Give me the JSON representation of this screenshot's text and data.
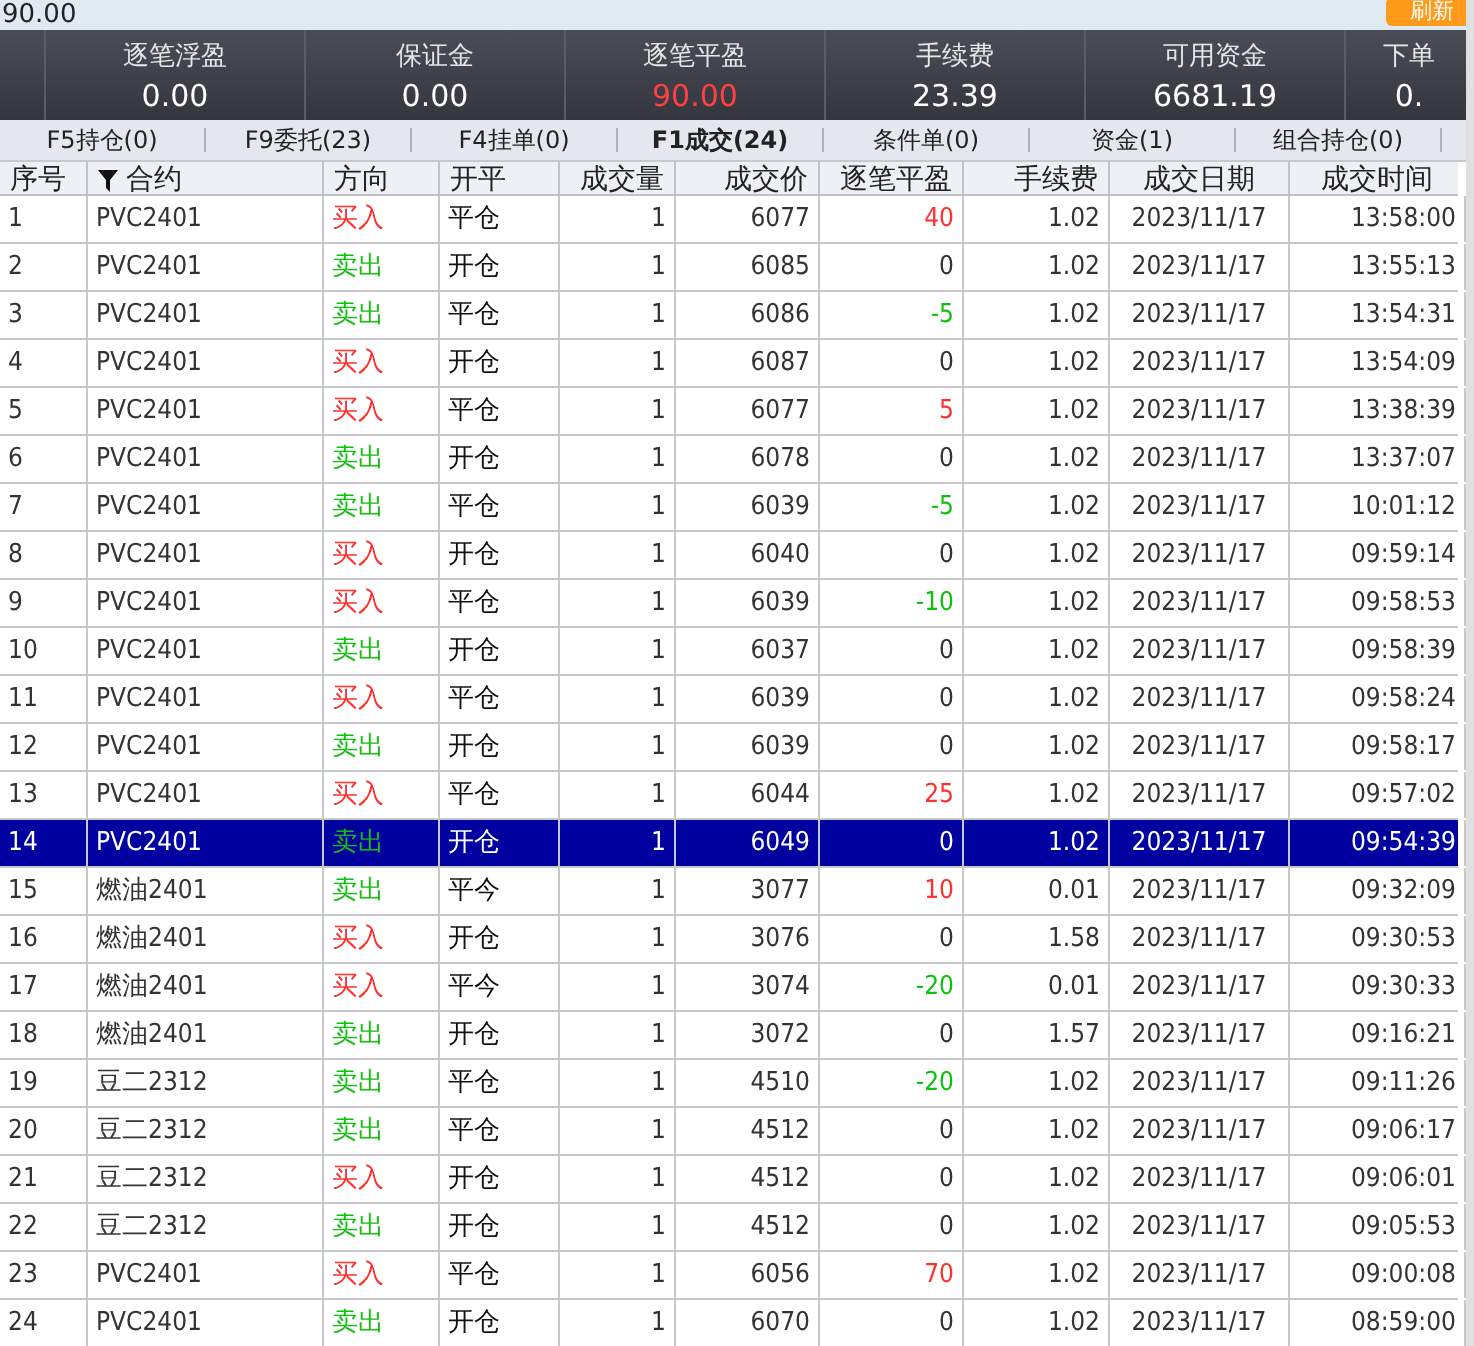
{
  "top_bar": {
    "value": "90.00",
    "refresh_button": "刷新"
  },
  "stats": [
    {
      "label": "逐笔浮盈",
      "value": "0.00",
      "color": "#ffffff"
    },
    {
      "label": "保证金",
      "value": "0.00",
      "color": "#ffffff"
    },
    {
      "label": "逐笔平盈",
      "value": "90.00",
      "color": "#ff4040"
    },
    {
      "label": "手续费",
      "value": "23.39",
      "color": "#ffffff"
    },
    {
      "label": "可用资金",
      "value": "6681.19",
      "color": "#ffffff"
    },
    {
      "label": "下单",
      "value": "0.",
      "color": "#ffffff"
    }
  ],
  "tabs": [
    {
      "label": "F5持仓(0)",
      "selected": false
    },
    {
      "label": "F9委托(23)",
      "selected": false
    },
    {
      "label": "F4挂单(0)",
      "selected": false
    },
    {
      "label": "F1成交(24)",
      "selected": true
    },
    {
      "label": "条件单(0)",
      "selected": false
    },
    {
      "label": "资金(1)",
      "selected": false
    },
    {
      "label": "组合持仓(0)",
      "selected": false
    }
  ],
  "table": {
    "columns": [
      "序号",
      "合约",
      "方向",
      "开平",
      "成交量",
      "成交价",
      "逐笔平盈",
      "手续费",
      "成交日期",
      "成交时间"
    ],
    "rows": [
      {
        "no": "1",
        "contract": "PVC2401",
        "direction": {
          "text": "买入",
          "color": "#ff3030"
        },
        "open_close": "平仓",
        "qty": "1",
        "price": "6077",
        "pnl": {
          "text": "40",
          "color": "#ff3030"
        },
        "fee": "1.02",
        "date": "2023/11/17",
        "time": "13:58:00",
        "selected": false
      },
      {
        "no": "2",
        "contract": "PVC2401",
        "direction": {
          "text": "卖出",
          "color": "#10c010"
        },
        "open_close": "开仓",
        "qty": "1",
        "price": "6085",
        "pnl": {
          "text": "0",
          "color": "#333333"
        },
        "fee": "1.02",
        "date": "2023/11/17",
        "time": "13:55:13",
        "selected": false
      },
      {
        "no": "3",
        "contract": "PVC2401",
        "direction": {
          "text": "卖出",
          "color": "#10c010"
        },
        "open_close": "平仓",
        "qty": "1",
        "price": "6086",
        "pnl": {
          "text": "-5",
          "color": "#10c010"
        },
        "fee": "1.02",
        "date": "2023/11/17",
        "time": "13:54:31",
        "selected": false
      },
      {
        "no": "4",
        "contract": "PVC2401",
        "direction": {
          "text": "买入",
          "color": "#ff3030"
        },
        "open_close": "开仓",
        "qty": "1",
        "price": "6087",
        "pnl": {
          "text": "0",
          "color": "#333333"
        },
        "fee": "1.02",
        "date": "2023/11/17",
        "time": "13:54:09",
        "selected": false
      },
      {
        "no": "5",
        "contract": "PVC2401",
        "direction": {
          "text": "买入",
          "color": "#ff3030"
        },
        "open_close": "平仓",
        "qty": "1",
        "price": "6077",
        "pnl": {
          "text": "5",
          "color": "#ff3030"
        },
        "fee": "1.02",
        "date": "2023/11/17",
        "time": "13:38:39",
        "selected": false
      },
      {
        "no": "6",
        "contract": "PVC2401",
        "direction": {
          "text": "卖出",
          "color": "#10c010"
        },
        "open_close": "开仓",
        "qty": "1",
        "price": "6078",
        "pnl": {
          "text": "0",
          "color": "#333333"
        },
        "fee": "1.02",
        "date": "2023/11/17",
        "time": "13:37:07",
        "selected": false
      },
      {
        "no": "7",
        "contract": "PVC2401",
        "direction": {
          "text": "卖出",
          "color": "#10c010"
        },
        "open_close": "平仓",
        "qty": "1",
        "price": "6039",
        "pnl": {
          "text": "-5",
          "color": "#10c010"
        },
        "fee": "1.02",
        "date": "2023/11/17",
        "time": "10:01:12",
        "selected": false
      },
      {
        "no": "8",
        "contract": "PVC2401",
        "direction": {
          "text": "买入",
          "color": "#ff3030"
        },
        "open_close": "开仓",
        "qty": "1",
        "price": "6040",
        "pnl": {
          "text": "0",
          "color": "#333333"
        },
        "fee": "1.02",
        "date": "2023/11/17",
        "time": "09:59:14",
        "selected": false
      },
      {
        "no": "9",
        "contract": "PVC2401",
        "direction": {
          "text": "买入",
          "color": "#ff3030"
        },
        "open_close": "平仓",
        "qty": "1",
        "price": "6039",
        "pnl": {
          "text": "-10",
          "color": "#10c010"
        },
        "fee": "1.02",
        "date": "2023/11/17",
        "time": "09:58:53",
        "selected": false
      },
      {
        "no": "10",
        "contract": "PVC2401",
        "direction": {
          "text": "卖出",
          "color": "#10c010"
        },
        "open_close": "开仓",
        "qty": "1",
        "price": "6037",
        "pnl": {
          "text": "0",
          "color": "#333333"
        },
        "fee": "1.02",
        "date": "2023/11/17",
        "time": "09:58:39",
        "selected": false
      },
      {
        "no": "11",
        "contract": "PVC2401",
        "direction": {
          "text": "买入",
          "color": "#ff3030"
        },
        "open_close": "平仓",
        "qty": "1",
        "price": "6039",
        "pnl": {
          "text": "0",
          "color": "#333333"
        },
        "fee": "1.02",
        "date": "2023/11/17",
        "time": "09:58:24",
        "selected": false
      },
      {
        "no": "12",
        "contract": "PVC2401",
        "direction": {
          "text": "卖出",
          "color": "#10c010"
        },
        "open_close": "开仓",
        "qty": "1",
        "price": "6039",
        "pnl": {
          "text": "0",
          "color": "#333333"
        },
        "fee": "1.02",
        "date": "2023/11/17",
        "time": "09:58:17",
        "selected": false
      },
      {
        "no": "13",
        "contract": "PVC2401",
        "direction": {
          "text": "买入",
          "color": "#ff3030"
        },
        "open_close": "平仓",
        "qty": "1",
        "price": "6044",
        "pnl": {
          "text": "25",
          "color": "#ff3030"
        },
        "fee": "1.02",
        "date": "2023/11/17",
        "time": "09:57:02",
        "selected": false
      },
      {
        "no": "14",
        "contract": "PVC2401",
        "direction": {
          "text": "卖出",
          "color": "#10c010"
        },
        "open_close": "开仓",
        "qty": "1",
        "price": "6049",
        "pnl": {
          "text": "0",
          "color": "#ffffff"
        },
        "fee": "1.02",
        "date": "2023/11/17",
        "time": "09:54:39",
        "selected": true
      },
      {
        "no": "15",
        "contract": "燃油2401",
        "direction": {
          "text": "卖出",
          "color": "#10c010"
        },
        "open_close": "平今",
        "qty": "1",
        "price": "3077",
        "pnl": {
          "text": "10",
          "color": "#ff3030"
        },
        "fee": "0.01",
        "date": "2023/11/17",
        "time": "09:32:09",
        "selected": false
      },
      {
        "no": "16",
        "contract": "燃油2401",
        "direction": {
          "text": "买入",
          "color": "#ff3030"
        },
        "open_close": "开仓",
        "qty": "1",
        "price": "3076",
        "pnl": {
          "text": "0",
          "color": "#333333"
        },
        "fee": "1.58",
        "date": "2023/11/17",
        "time": "09:30:53",
        "selected": false
      },
      {
        "no": "17",
        "contract": "燃油2401",
        "direction": {
          "text": "买入",
          "color": "#ff3030"
        },
        "open_close": "平今",
        "qty": "1",
        "price": "3074",
        "pnl": {
          "text": "-20",
          "color": "#10c010"
        },
        "fee": "0.01",
        "date": "2023/11/17",
        "time": "09:30:33",
        "selected": false
      },
      {
        "no": "18",
        "contract": "燃油2401",
        "direction": {
          "text": "卖出",
          "color": "#10c010"
        },
        "open_close": "开仓",
        "qty": "1",
        "price": "3072",
        "pnl": {
          "text": "0",
          "color": "#333333"
        },
        "fee": "1.57",
        "date": "2023/11/17",
        "time": "09:16:21",
        "selected": false
      },
      {
        "no": "19",
        "contract": "豆二2312",
        "direction": {
          "text": "卖出",
          "color": "#10c010"
        },
        "open_close": "平仓",
        "qty": "1",
        "price": "4510",
        "pnl": {
          "text": "-20",
          "color": "#10c010"
        },
        "fee": "1.02",
        "date": "2023/11/17",
        "time": "09:11:26",
        "selected": false
      },
      {
        "no": "20",
        "contract": "豆二2312",
        "direction": {
          "text": "卖出",
          "color": "#10c010"
        },
        "open_close": "平仓",
        "qty": "1",
        "price": "4512",
        "pnl": {
          "text": "0",
          "color": "#333333"
        },
        "fee": "1.02",
        "date": "2023/11/17",
        "time": "09:06:17",
        "selected": false
      },
      {
        "no": "21",
        "contract": "豆二2312",
        "direction": {
          "text": "买入",
          "color": "#ff3030"
        },
        "open_close": "开仓",
        "qty": "1",
        "price": "4512",
        "pnl": {
          "text": "0",
          "color": "#333333"
        },
        "fee": "1.02",
        "date": "2023/11/17",
        "time": "09:06:01",
        "selected": false
      },
      {
        "no": "22",
        "contract": "豆二2312",
        "direction": {
          "text": "卖出",
          "color": "#10c010"
        },
        "open_close": "开仓",
        "qty": "1",
        "price": "4512",
        "pnl": {
          "text": "0",
          "color": "#333333"
        },
        "fee": "1.02",
        "date": "2023/11/17",
        "time": "09:05:53",
        "selected": false
      },
      {
        "no": "23",
        "contract": "PVC2401",
        "direction": {
          "text": "买入",
          "color": "#ff3030"
        },
        "open_close": "平仓",
        "qty": "1",
        "price": "6056",
        "pnl": {
          "text": "70",
          "color": "#ff3030"
        },
        "fee": "1.02",
        "date": "2023/11/17",
        "time": "09:00:08",
        "selected": false
      },
      {
        "no": "24",
        "contract": "PVC2401",
        "direction": {
          "text": "卖出",
          "color": "#10c010"
        },
        "open_close": "开仓",
        "qty": "1",
        "price": "6070",
        "pnl": {
          "text": "0",
          "color": "#333333"
        },
        "fee": "1.02",
        "date": "2023/11/17",
        "time": "08:59:00",
        "selected": false
      }
    ]
  }
}
